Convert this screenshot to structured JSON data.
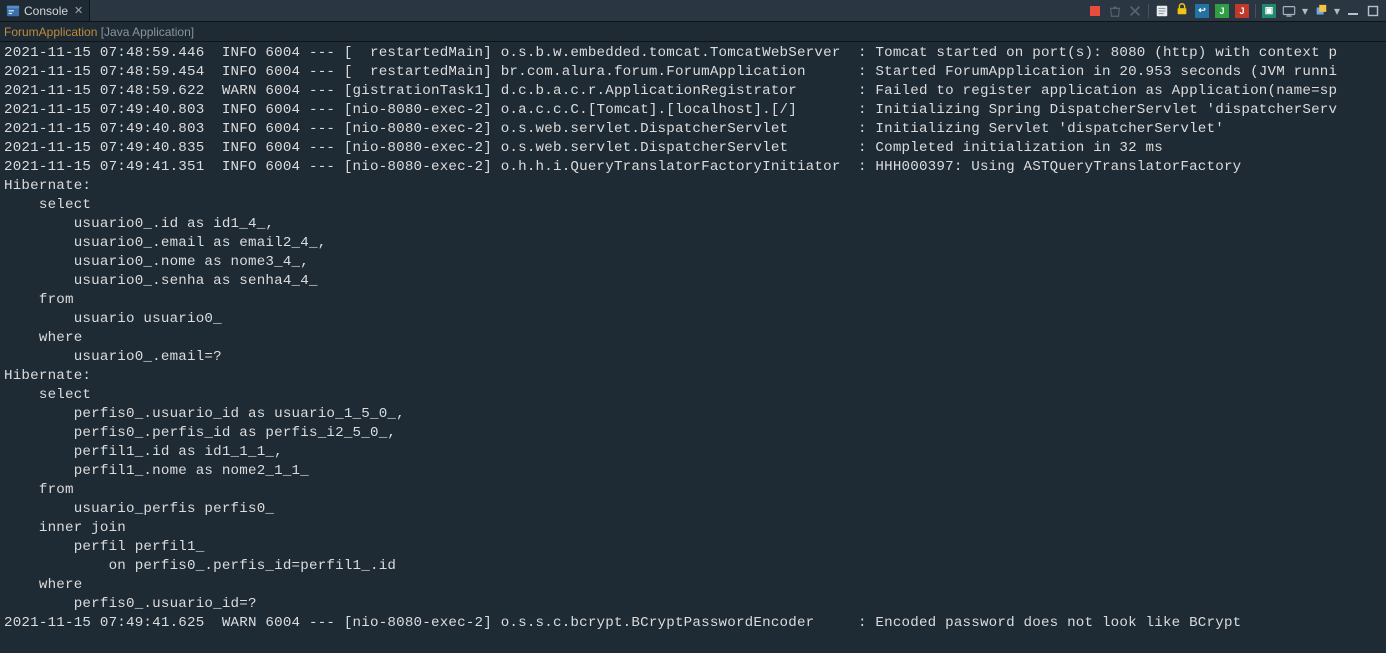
{
  "tab": {
    "title": "Console"
  },
  "launch": {
    "app": "ForumApplication",
    "type": "[Java Application]"
  },
  "toolbar": {
    "icons": [
      "stop",
      "relaunch",
      "clear",
      "vsep",
      "pin",
      "lock",
      "scroll",
      "out",
      "err",
      "vsep",
      "display-selected",
      "monitor",
      "vsep",
      "menu",
      "vsep",
      "min",
      "max"
    ]
  },
  "log_lines": [
    "2021-11-15 07:48:59.446  INFO 6004 --- [  restartedMain] o.s.b.w.embedded.tomcat.TomcatWebServer  : Tomcat started on port(s): 8080 (http) with context p",
    "2021-11-15 07:48:59.454  INFO 6004 --- [  restartedMain] br.com.alura.forum.ForumApplication      : Started ForumApplication in 20.953 seconds (JVM runni",
    "2021-11-15 07:48:59.622  WARN 6004 --- [gistrationTask1] d.c.b.a.c.r.ApplicationRegistrator       : Failed to register application as Application(name=sp",
    "2021-11-15 07:49:40.803  INFO 6004 --- [nio-8080-exec-2] o.a.c.c.C.[Tomcat].[localhost].[/]       : Initializing Spring DispatcherServlet 'dispatcherServ",
    "2021-11-15 07:49:40.803  INFO 6004 --- [nio-8080-exec-2] o.s.web.servlet.DispatcherServlet        : Initializing Servlet 'dispatcherServlet'",
    "2021-11-15 07:49:40.835  INFO 6004 --- [nio-8080-exec-2] o.s.web.servlet.DispatcherServlet        : Completed initialization in 32 ms",
    "2021-11-15 07:49:41.351  INFO 6004 --- [nio-8080-exec-2] o.h.h.i.QueryTranslatorFactoryInitiator  : HHH000397: Using ASTQueryTranslatorFactory",
    "Hibernate: ",
    "    select",
    "        usuario0_.id as id1_4_,",
    "        usuario0_.email as email2_4_,",
    "        usuario0_.nome as nome3_4_,",
    "        usuario0_.senha as senha4_4_ ",
    "    from",
    "        usuario usuario0_ ",
    "    where",
    "        usuario0_.email=?",
    "Hibernate: ",
    "    select",
    "        perfis0_.usuario_id as usuario_1_5_0_,",
    "        perfis0_.perfis_id as perfis_i2_5_0_,",
    "        perfil1_.id as id1_1_1_,",
    "        perfil1_.nome as nome2_1_1_ ",
    "    from",
    "        usuario_perfis perfis0_ ",
    "    inner join",
    "        perfil perfil1_ ",
    "            on perfis0_.perfis_id=perfil1_.id ",
    "    where",
    "        perfis0_.usuario_id=?",
    "2021-11-15 07:49:41.625  WARN 6004 --- [nio-8080-exec-2] o.s.s.c.bcrypt.BCryptPasswordEncoder     : Encoded password does not look like BCrypt"
  ]
}
